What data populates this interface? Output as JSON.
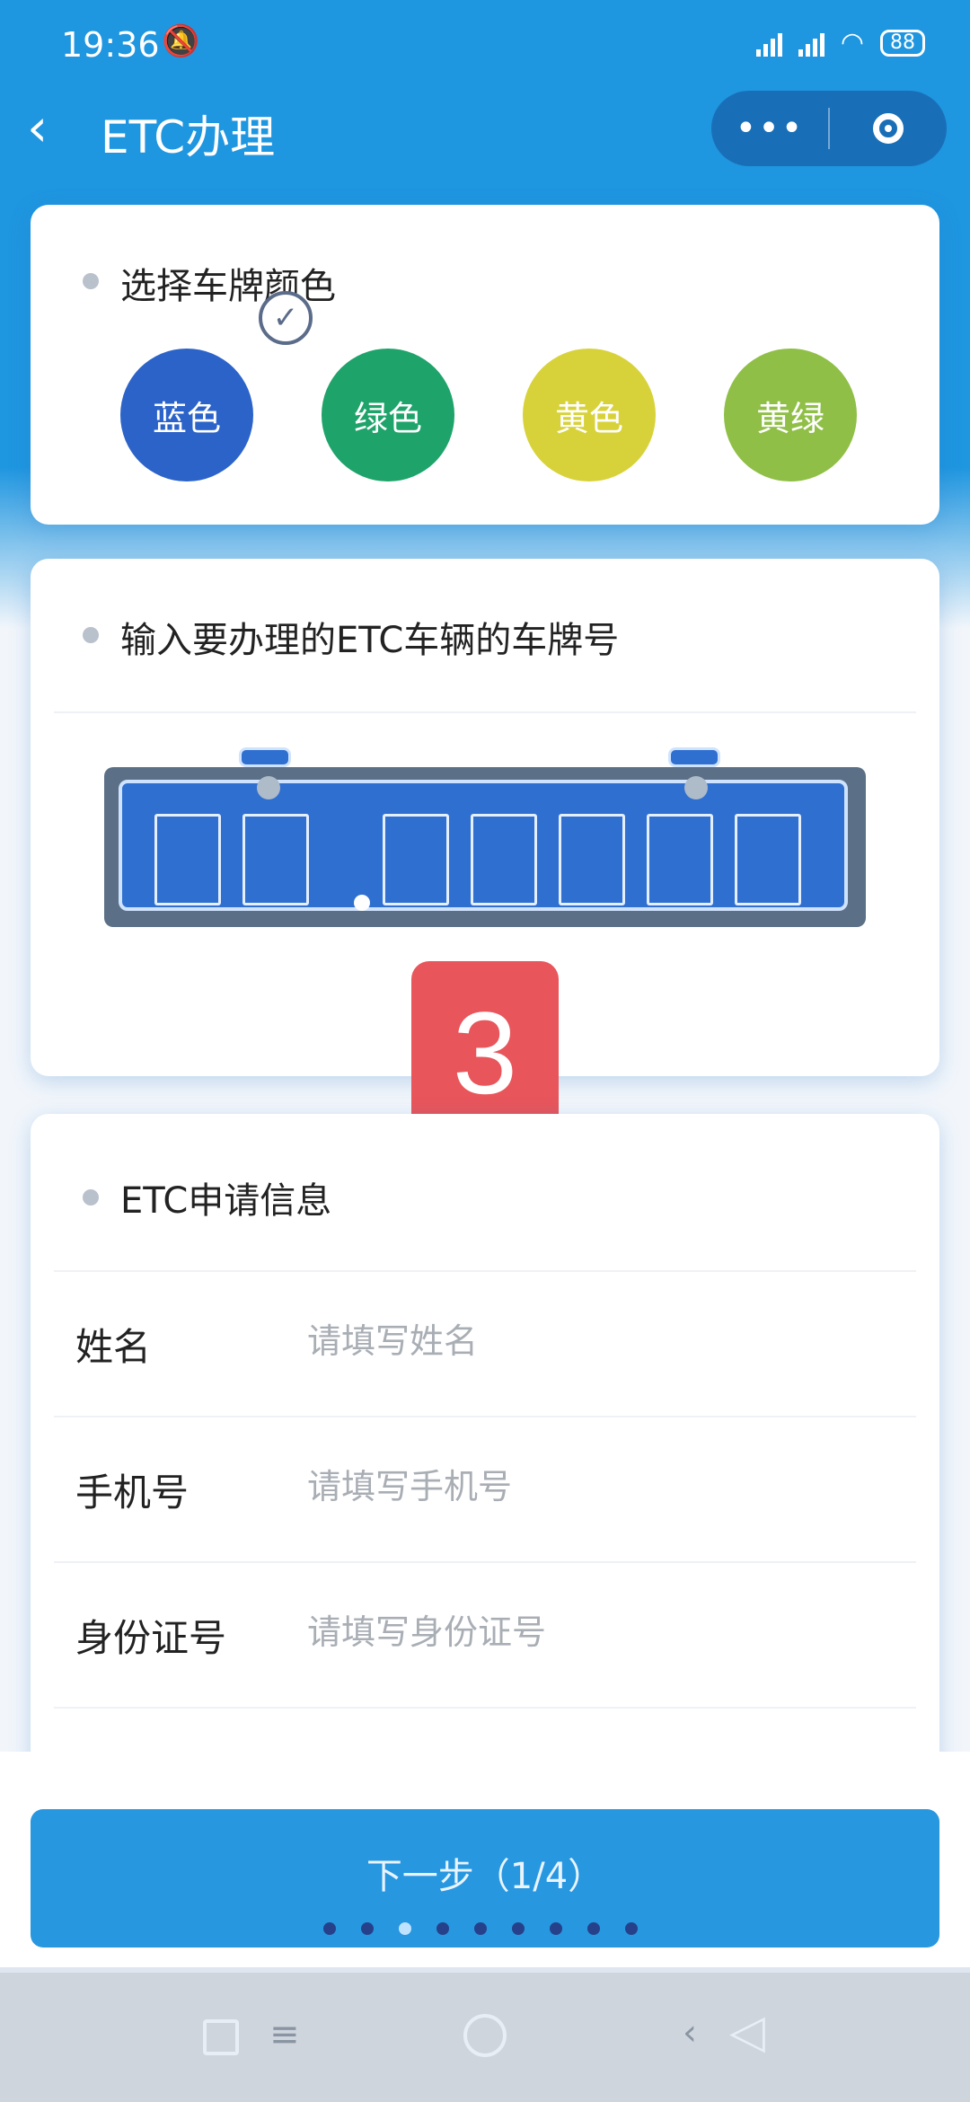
{
  "status_bar": {
    "time": "19:36",
    "battery": "88"
  },
  "nav": {
    "back_icon": "‹",
    "title": "ETC办理",
    "more_icon": "•••"
  },
  "color_section": {
    "title": "选择车牌颜色",
    "options": [
      {
        "label": "蓝色",
        "color": "#2b63c9",
        "selected": true
      },
      {
        "label": "绿色",
        "color": "#1ea36a",
        "selected": false
      },
      {
        "label": "黄色",
        "color": "#d8d23a",
        "selected": false
      },
      {
        "label": "黄绿",
        "color": "#8fbf46",
        "selected": false
      }
    ],
    "check_icon": "✓"
  },
  "plate_section": {
    "title": "输入要办理的ETC车辆的车牌号",
    "plate_color": "#2f6fd0"
  },
  "badge": {
    "text": "3"
  },
  "apply_section": {
    "title": "ETC申请信息",
    "fields": [
      {
        "label": "姓名",
        "placeholder": "请填写姓名"
      },
      {
        "label": "手机号",
        "placeholder": "请填写手机号"
      },
      {
        "label": "身份证号",
        "placeholder": "请填写身份证号"
      }
    ]
  },
  "next_button": {
    "label": "下一步（1/4）"
  },
  "theme": {
    "primary": "#2797e0",
    "badge_red": "#e8555b"
  }
}
